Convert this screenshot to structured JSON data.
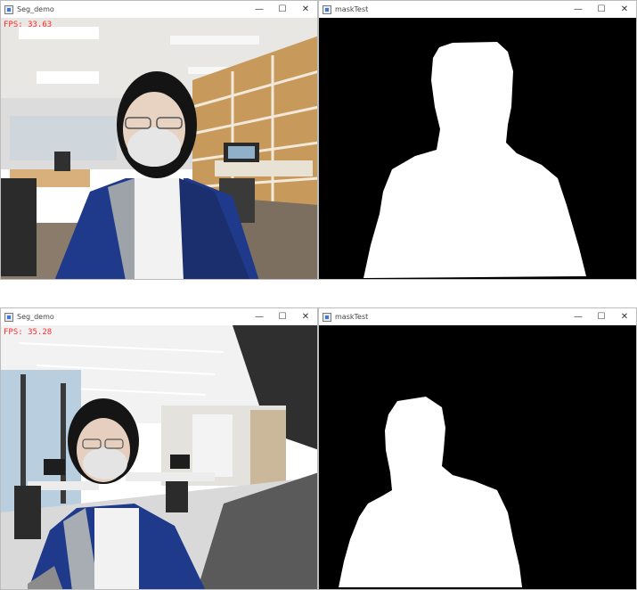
{
  "windows": [
    {
      "title": "Seg_demo",
      "fps": "FPS: 33.63"
    },
    {
      "title": "maskTest"
    },
    {
      "title": "Seg_demo",
      "fps": "FPS: 35.28"
    },
    {
      "title": "maskTest"
    }
  ],
  "controls": {
    "minimize": "—",
    "maximize": "☐",
    "close": "✕"
  },
  "icons": {
    "app": "app-window-icon"
  }
}
